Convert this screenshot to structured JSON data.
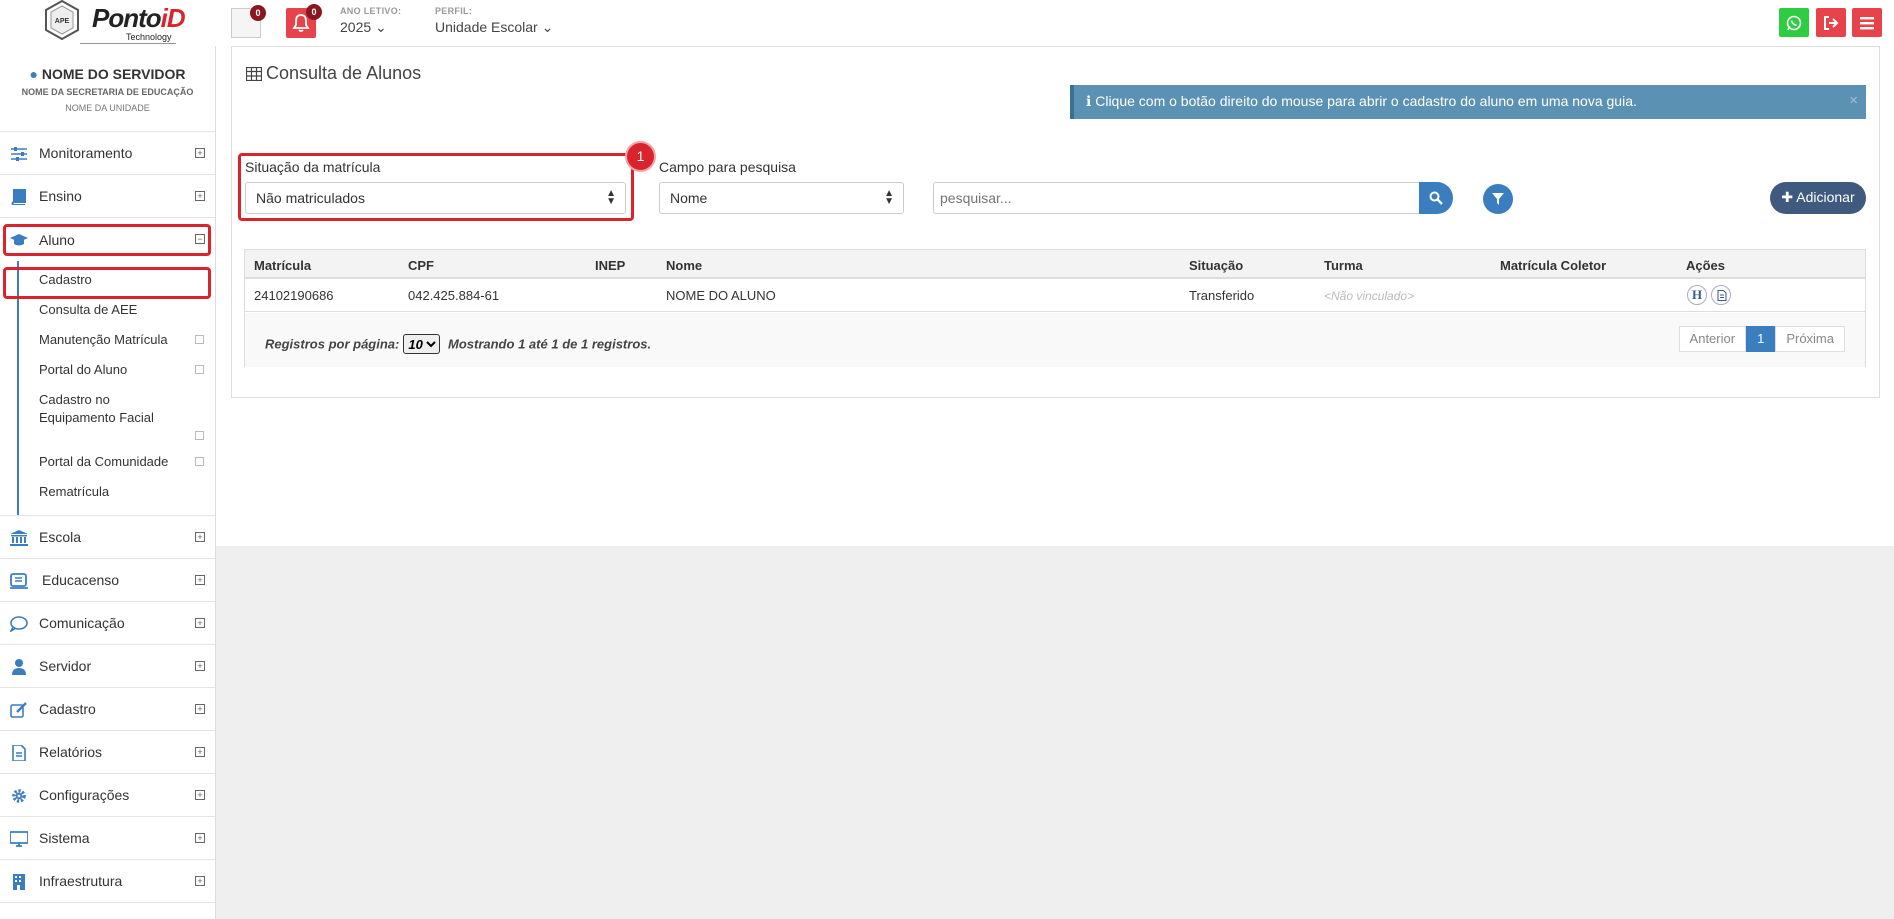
{
  "header": {
    "brand_main": "Ponto",
    "brand_accent": "iD",
    "brand_sub": "Technology",
    "hex_label": "APE",
    "doc_badge": "0",
    "bell_badge": "0",
    "ano_label": "ANO LETIVO:",
    "ano_value": "2025 ⌄",
    "perfil_label": "PERFIL:",
    "perfil_value": "Unidade Escolar ⌄"
  },
  "sidebar": {
    "user_name": "NOME DO SERVIDOR",
    "secretaria": "NOME DA SECRETARIA DE EDUCAÇÃO",
    "unidade": "NOME DA UNIDADE",
    "items": [
      {
        "label": "Monitoramento",
        "icon": "sliders-icon"
      },
      {
        "label": "Ensino",
        "icon": "book-icon"
      },
      {
        "label": "Aluno",
        "icon": "graduation-cap-icon"
      },
      {
        "label": "Escola",
        "icon": "institution-icon"
      },
      {
        "label": "Educacenso",
        "icon": "educacenso-icon"
      },
      {
        "label": "Comunicação",
        "icon": "chat-bubble-icon"
      },
      {
        "label": "Servidor",
        "icon": "user-icon"
      },
      {
        "label": "Cadastro",
        "icon": "edit-icon"
      },
      {
        "label": "Relatórios",
        "icon": "file-icon"
      },
      {
        "label": "Configurações",
        "icon": "gear-icon"
      },
      {
        "label": "Sistema",
        "icon": "monitor-icon"
      },
      {
        "label": "Infraestrutura",
        "icon": "building-icon"
      }
    ],
    "aluno_sub": [
      {
        "label": "Cadastro"
      },
      {
        "label": "Consulta de AEE"
      },
      {
        "label": "Manutenção Matrícula"
      },
      {
        "label": "Portal do Aluno"
      },
      {
        "label": "Cadastro no Equipamento Facial"
      },
      {
        "label": "Portal da Comunidade"
      },
      {
        "label": "Rematrícula"
      }
    ]
  },
  "main": {
    "title": "Consulta de Alunos",
    "alert": "Clique com o botão direito do mouse para abrir o cadastro do aluno em uma nova guia.",
    "alert_close": "×",
    "step_badge": "1",
    "situacao_label": "Situação da matrícula",
    "situacao_value": "Não matriculados",
    "campo_label": "Campo para pesquisa",
    "campo_value": "Nome",
    "search_placeholder": "pesquisar...",
    "add_label": "Adicionar",
    "table": {
      "columns": [
        "Matrícula",
        "CPF",
        "INEP",
        "Nome",
        "Situação",
        "Turma",
        "Matrícula Coletor",
        "Ações"
      ],
      "rows": [
        {
          "matricula": "24102190686",
          "cpf": "042.425.884-61",
          "inep": "",
          "nome": "NOME DO ALUNO",
          "situacao": "Transferido",
          "turma": "<Não vinculado>",
          "coletor": ""
        }
      ],
      "action_h": "H",
      "rpp_label": "Registros por página:",
      "rpp_value": "10",
      "showing_1": "Mostrando",
      "showing_from": "1",
      "showing_2": "até",
      "showing_to": "1",
      "showing_3": "de",
      "showing_total": "1",
      "showing_4": "registros.",
      "prev": "Anterior",
      "page": "1",
      "next": "Próxima"
    }
  },
  "colors": {
    "primary": "#3a7ebf",
    "danger": "#e8434b",
    "highlight": "#d9242d",
    "alert_bg": "#5b92b3",
    "whatsapp": "#2ecc40"
  }
}
